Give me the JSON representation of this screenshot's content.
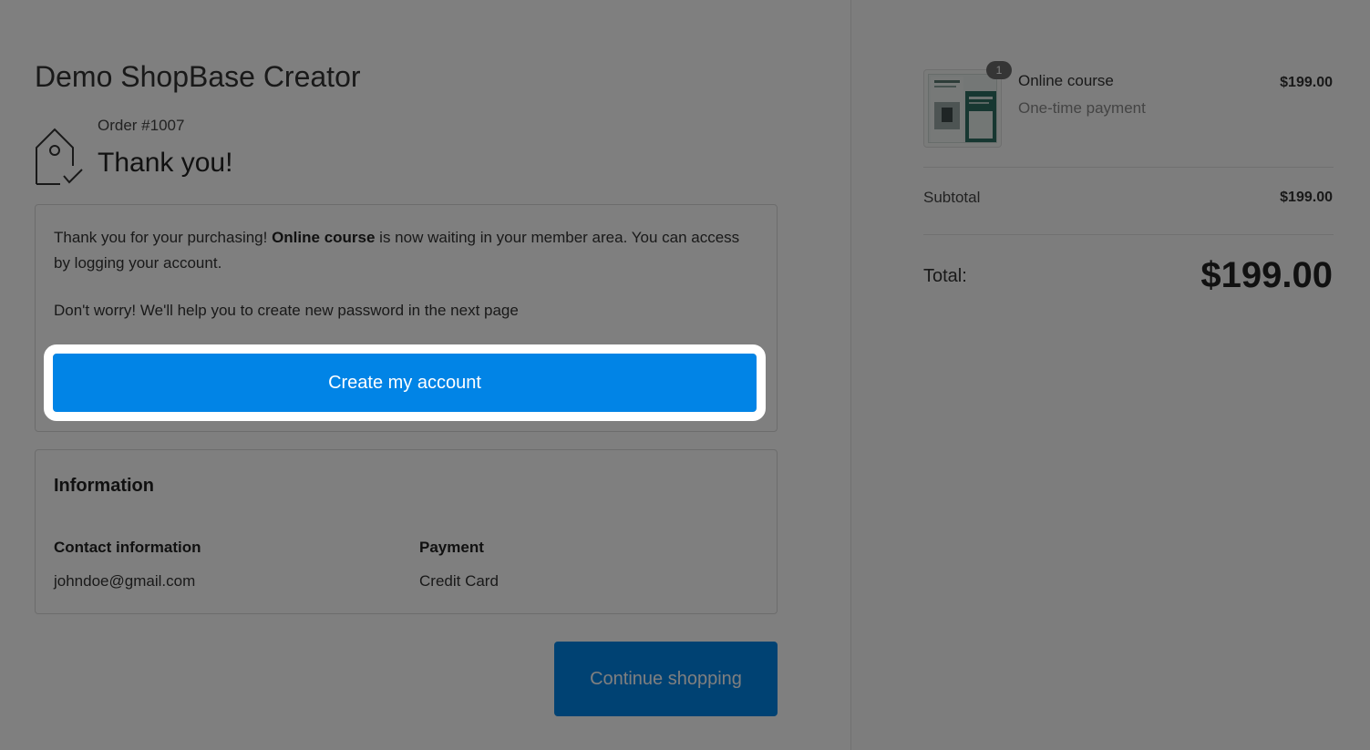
{
  "store": {
    "title": "Demo ShopBase Creator"
  },
  "order": {
    "number": "Order #1007",
    "thanks": "Thank you!",
    "icon": "tag-check-icon"
  },
  "message": {
    "part1": "Thank you for your purchasing! ",
    "product_bold": "Online course",
    "part2": " is now waiting in your member area. You can access by logging your account.",
    "note": "Don't worry! We'll help you to create new password in the next page",
    "create_button": "Create my account"
  },
  "information": {
    "title": "Information",
    "contact_label": "Contact information",
    "contact_value": "johndoe@gmail.com",
    "payment_label": "Payment",
    "payment_value": "Credit Card"
  },
  "continue_button": "Continue shopping",
  "summary": {
    "item": {
      "quantity": "1",
      "name": "Online course",
      "subtitle": "One-time payment",
      "price": "$199.00"
    },
    "subtotal_label": "Subtotal",
    "subtotal_value": "$199.00",
    "total_label": "Total:",
    "total_value": "$199.00"
  },
  "colors": {
    "primary": "#0184e6",
    "overlay": "rgba(0,0,0,0.5)"
  }
}
